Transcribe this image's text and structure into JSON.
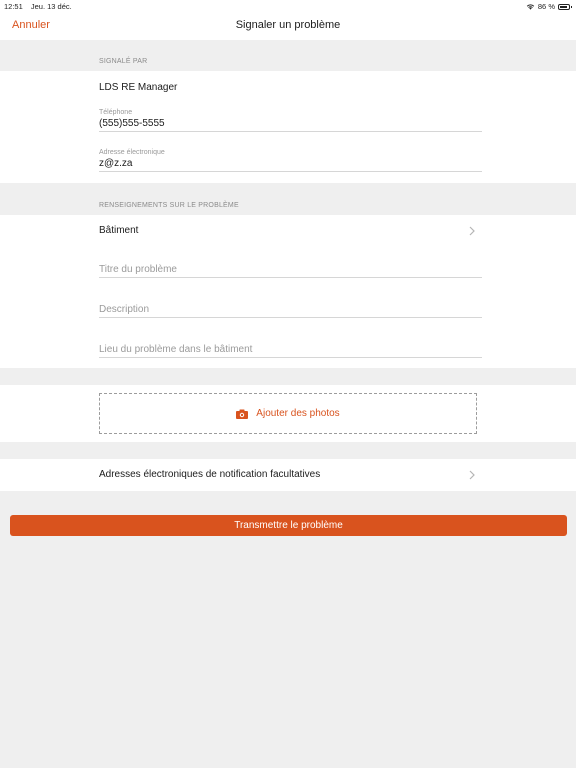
{
  "status_bar": {
    "time": "12:51",
    "date": "Jeu. 13 déc.",
    "battery": "86 %",
    "battery_level": 0.86
  },
  "nav": {
    "cancel_label": "Annuler",
    "title": "Signaler un problème"
  },
  "reported_by": {
    "header": "SIGNALÉ PAR",
    "name": "LDS RE Manager",
    "phone_label": "Téléphone",
    "phone_value": "(555)555-5555",
    "email_label": "Adresse électronique",
    "email_value": "z@z.za"
  },
  "problem_info": {
    "header": "RENSEIGNEMENTS SUR LE PROBLÈME",
    "building_label": "Bâtiment",
    "title_placeholder": "Titre du problème",
    "description_placeholder": "Description",
    "location_placeholder": "Lieu du problème dans le bâtiment"
  },
  "photos": {
    "add_label": "Ajouter des photos",
    "icon": "camera-icon"
  },
  "notifications": {
    "label": "Adresses électroniques de notification facultatives"
  },
  "submit": {
    "label": "Transmettre le problème"
  },
  "colors": {
    "accent": "#d9531e",
    "background": "#efefef"
  }
}
